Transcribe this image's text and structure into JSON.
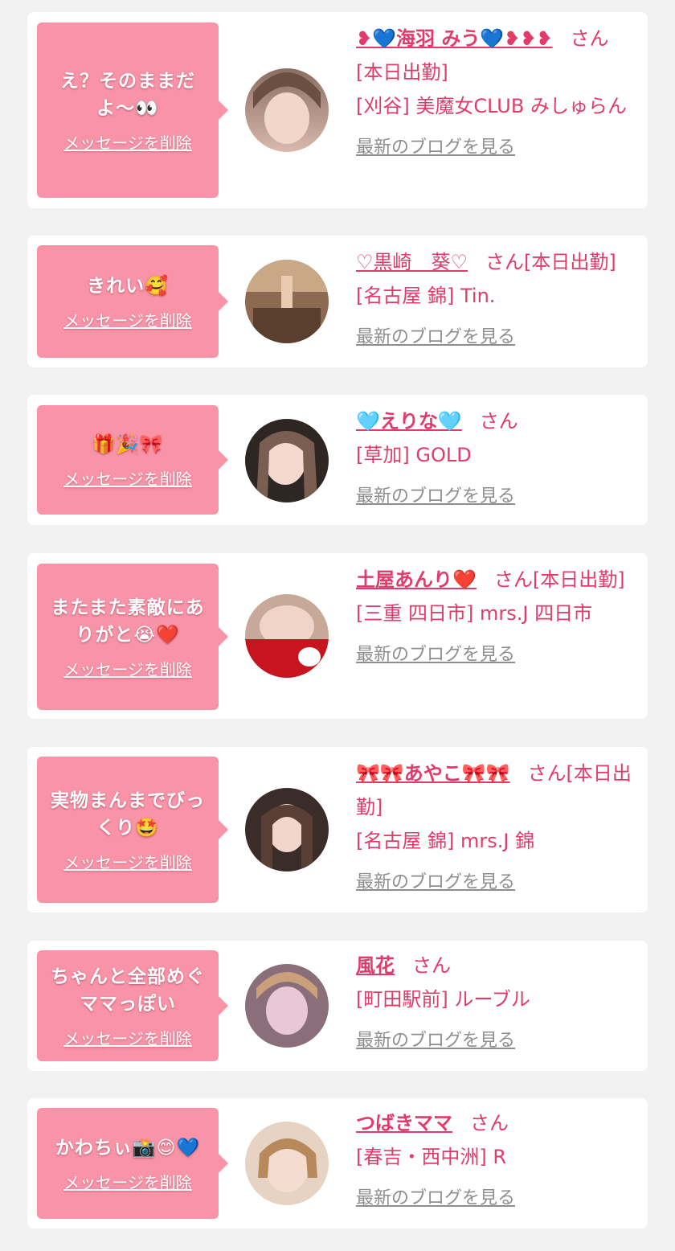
{
  "colors": {
    "background": "#f2f2f2",
    "card": "#ffffff",
    "bubble": "#f993a7",
    "accent": "#e23b6b",
    "link_gray": "#8e8e8e"
  },
  "items": [
    {
      "message": "え？そのままだよ〜👀",
      "delete_label": "メッセージを削除",
      "name": "❥💙海羽 みう💙❥❥❥",
      "san": "さん",
      "status": "[本日出勤]",
      "area_shop": "[刈谷] 美魔女CLUB みしゅらん",
      "blog_label": "最新のブログを見る",
      "avatar_icon": "profile-photo"
    },
    {
      "message": "きれい🥰",
      "delete_label": "メッセージを削除",
      "name": "♡黒崎　葵♡",
      "san": "さん",
      "status": "[本日出勤]",
      "area_shop": "[名古屋 錦] Tin.",
      "blog_label": "最新のブログを見る",
      "avatar_icon": "profile-photo"
    },
    {
      "message": "🎁🎉🎀",
      "delete_label": "メッセージを削除",
      "name": "🩵えりな🩵",
      "san": "さん",
      "status": "",
      "area_shop": "[草加] GOLD",
      "blog_label": "最新のブログを見る",
      "avatar_icon": "profile-photo"
    },
    {
      "message": "またまた素敵にありがと😭❤️",
      "delete_label": "メッセージを削除",
      "name": "土屋あんり❤️",
      "san": "さん",
      "status": "[本日出勤]",
      "area_shop": "[三重 四日市] mrs.J 四日市",
      "blog_label": "最新のブログを見る",
      "avatar_icon": "profile-photo"
    },
    {
      "message": "実物まんまでびっくり🤩",
      "delete_label": "メッセージを削除",
      "name": "🎀🎀あやこ🎀🎀",
      "san": "さん",
      "status": "[本日出勤]",
      "area_shop": "[名古屋 錦] mrs.J 錦",
      "blog_label": "最新のブログを見る",
      "avatar_icon": "profile-photo"
    },
    {
      "message": "ちゃんと全部めぐママっぽい",
      "delete_label": "メッセージを削除",
      "name": "風花",
      "san": "さん",
      "status": "",
      "area_shop": "[町田駅前] ルーブル",
      "blog_label": "最新のブログを見る",
      "avatar_icon": "profile-photo"
    },
    {
      "message": "かわちぃ📸😊💙",
      "delete_label": "メッセージを削除",
      "name": "つばきママ",
      "san": "さん",
      "status": "",
      "area_shop": "[春吉・西中洲] R",
      "blog_label": "最新のブログを見る",
      "avatar_icon": "profile-photo"
    }
  ]
}
